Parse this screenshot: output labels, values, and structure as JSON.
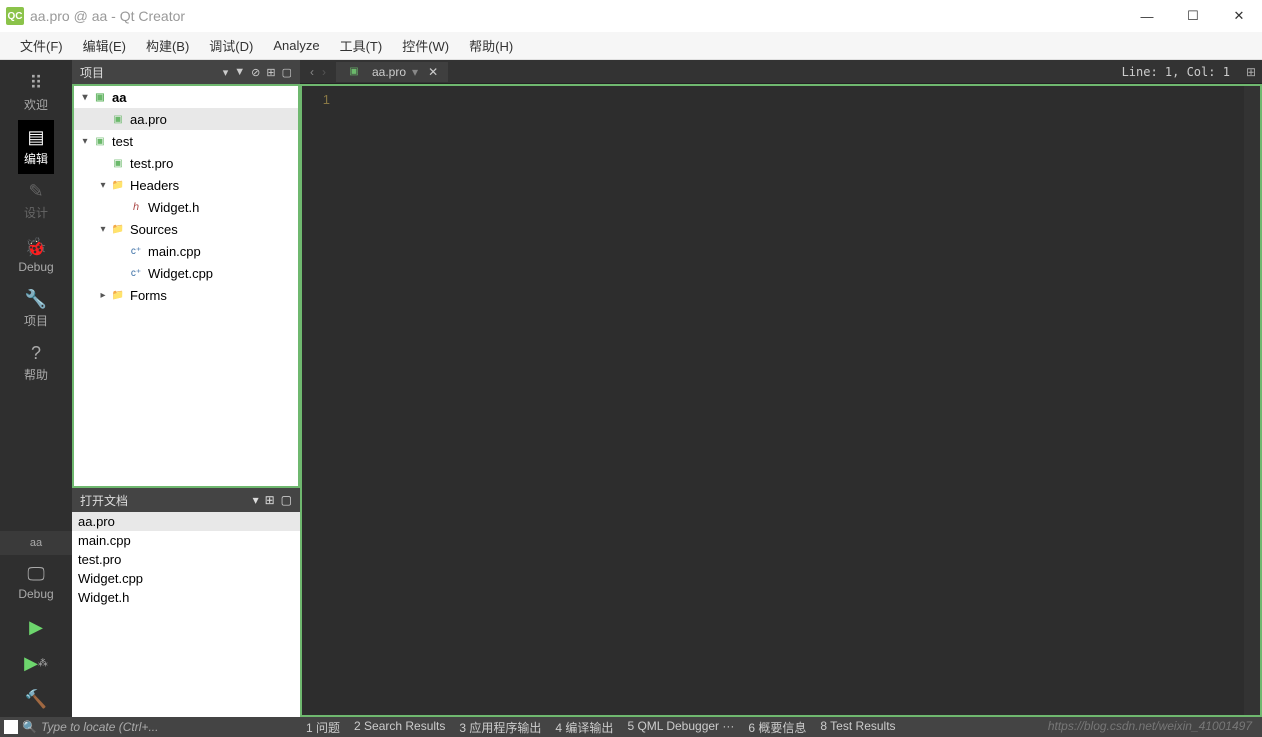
{
  "window": {
    "title": "aa.pro @ aa - Qt Creator",
    "logo": "QC"
  },
  "menus": [
    "文件(F)",
    "编辑(E)",
    "构建(B)",
    "调试(D)",
    "Analyze",
    "工具(T)",
    "控件(W)",
    "帮助(H)"
  ],
  "leftnav": [
    {
      "icon": "⠿",
      "label": "欢迎",
      "active": false
    },
    {
      "icon": "▤",
      "label": "编辑",
      "active": true
    },
    {
      "icon": "✎",
      "label": "设计",
      "disabled": true
    },
    {
      "icon": "🐞",
      "label": "Debug"
    },
    {
      "icon": "🔧",
      "label": "项目"
    },
    {
      "icon": "?",
      "label": "帮助"
    }
  ],
  "project_selected": "aa",
  "debug_label": "Debug",
  "projects_panel": {
    "title": "项目",
    "tools": [
      "▾",
      "▼",
      "⊘",
      "⊞",
      "▢"
    ]
  },
  "tree": [
    {
      "level": 0,
      "chevron": "▾",
      "icon": "qt",
      "label": "aa",
      "bold": true
    },
    {
      "level": 1,
      "chevron": "",
      "icon": "qt",
      "label": "aa.pro",
      "selected": true
    },
    {
      "level": 0,
      "chevron": "▾",
      "icon": "qt",
      "label": "test"
    },
    {
      "level": 1,
      "chevron": "",
      "icon": "qt",
      "label": "test.pro"
    },
    {
      "level": 1,
      "chevron": "▾",
      "icon": "folder",
      "label": "Headers"
    },
    {
      "level": 2,
      "chevron": "",
      "icon": "h",
      "label": "Widget.h"
    },
    {
      "level": 1,
      "chevron": "▾",
      "icon": "folder",
      "label": "Sources"
    },
    {
      "level": 2,
      "chevron": "",
      "icon": "cpp",
      "label": "main.cpp"
    },
    {
      "level": 2,
      "chevron": "",
      "icon": "cpp",
      "label": "Widget.cpp"
    },
    {
      "level": 1,
      "chevron": "▸",
      "icon": "folder",
      "label": "Forms"
    }
  ],
  "open_docs": {
    "title": "打开文档",
    "tools": [
      "▾",
      "⊞",
      "▢"
    ],
    "items": [
      "aa.pro",
      "main.cpp",
      "test.pro",
      "Widget.cpp",
      "Widget.h"
    ],
    "selected": 0
  },
  "editor": {
    "tab_label": "aa.pro",
    "line_number": "1",
    "status": "Line: 1, Col: 1"
  },
  "locator_placeholder": "Type to locate (Ctrl+...",
  "bottom_tabs": [
    "1 问题",
    "2 Search Results",
    "3 应用程序输出",
    "4 编译输出",
    "5 QML Debugger ···",
    "6 概要信息",
    "8 Test Results"
  ],
  "watermark": "https://blog.csdn.net/weixin_41001497"
}
